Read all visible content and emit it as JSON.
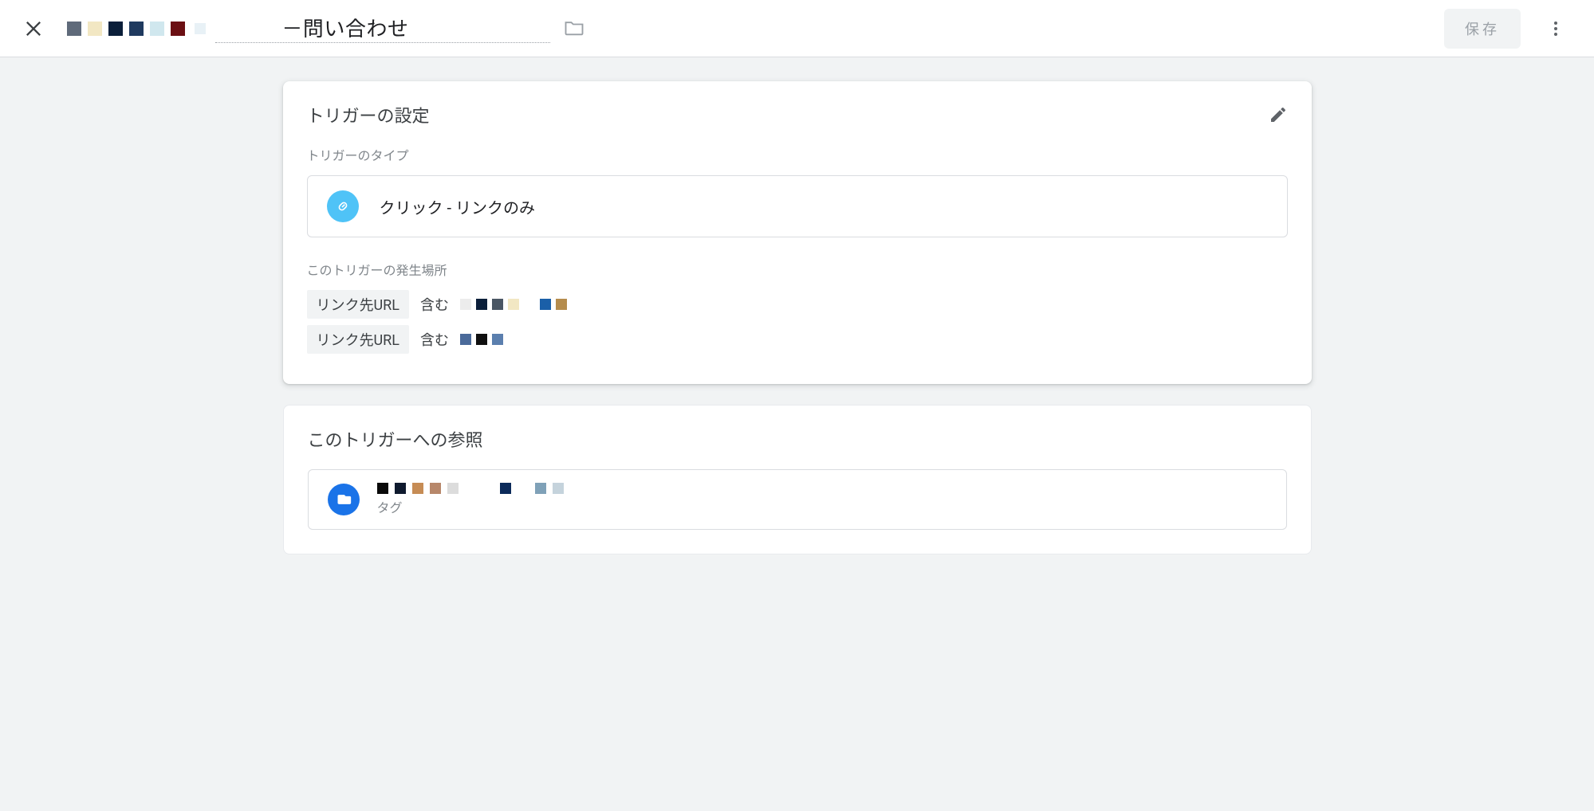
{
  "header": {
    "title_suffix": "－問い合わせ",
    "title_redaction_colors": [
      "#5f6a7a",
      "#f2e7c3",
      "#0b1f3a",
      "#1f3a5f",
      "#d0e7ee",
      "#6b0f13"
    ],
    "title_light_block": "#e8f1f6",
    "save_label": "保存"
  },
  "trigger_settings": {
    "card_title": "トリガーの設定",
    "type_label": "トリガーのタイプ",
    "type_name": "クリック - リンクのみ",
    "conditions_label": "このトリガーの発生場所",
    "conditions": [
      {
        "variable": "リンク先URL",
        "operator": "含む",
        "value_redaction_colors": [
          "#ececec",
          "#0b1f3a",
          "#4a5664",
          "#f2e7c3",
          "#ffffff",
          "#1a5fa8",
          "#b58c4d"
        ]
      },
      {
        "variable": "リンク先URL",
        "operator": "含む",
        "value_redaction_colors": [
          "#4a6a9a",
          "#101010",
          "#5b7fae"
        ]
      }
    ]
  },
  "references": {
    "card_title": "このトリガーへの参照",
    "items": [
      {
        "type_label": "タグ",
        "name_redaction_colors": [
          "#090909",
          "#0f1a2e",
          "#c68c55",
          "#b7876a",
          "#dcdcdc",
          "#ffffff",
          "#ffffff",
          "#0b2a5a",
          "#ffffff",
          "#7fa1b8",
          "#c5d3dc"
        ]
      }
    ]
  }
}
